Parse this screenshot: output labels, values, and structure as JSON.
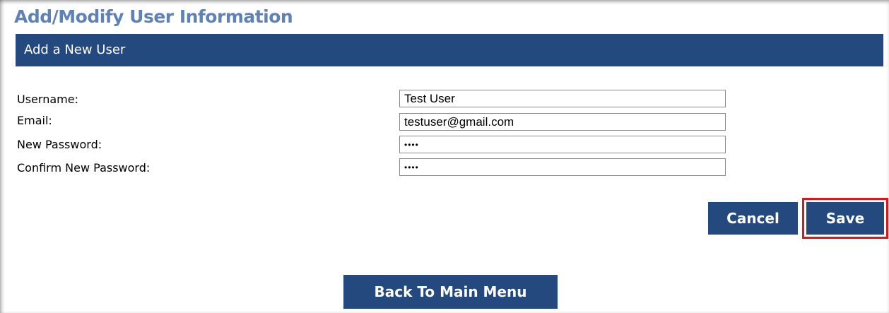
{
  "page": {
    "title": "Add/Modify User Information"
  },
  "section": {
    "header": "Add a New User"
  },
  "form": {
    "username": {
      "label": "Username:",
      "value": "Test User"
    },
    "email": {
      "label": "Email:",
      "value": "testuser@gmail.com"
    },
    "new_password": {
      "label": "New Password:",
      "value": "test"
    },
    "confirm_password": {
      "label": "Confirm New Password:",
      "value": "test"
    }
  },
  "actions": {
    "cancel_label": "Cancel",
    "save_label": "Save",
    "back_label": "Back To Main Menu",
    "highlighted": "Save"
  },
  "colors": {
    "title": "#5e82b8",
    "header_bar": "#24497f",
    "button": "#24497f",
    "highlight": "#e3131a"
  }
}
